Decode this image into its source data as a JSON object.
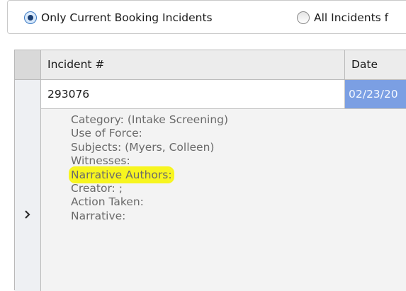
{
  "filter": {
    "options": [
      {
        "label": "Only Current Booking Incidents",
        "selected": true
      },
      {
        "label": "All Incidents f",
        "selected": false
      }
    ]
  },
  "grid": {
    "columns": [
      "Incident #",
      "Date"
    ],
    "row": {
      "incident_number": "293076",
      "date": "02/23/20"
    },
    "detail": {
      "category": "Category: (Intake Screening)",
      "use_of_force": "Use of Force:",
      "subjects": "Subjects: (Myers, Colleen)",
      "witnesses": "Witnesses:",
      "narrative_authors": "Narrative Authors:",
      "creator": "Creator: ;",
      "action_taken": "Action Taken:",
      "narrative": "Narrative:"
    }
  },
  "colors": {
    "selected_cell": "#7b9fe3",
    "highlight": "#f7f51f",
    "radio_accent": "#3e7bc4"
  },
  "icons": {
    "row_expand": "chevron-right-icon"
  }
}
